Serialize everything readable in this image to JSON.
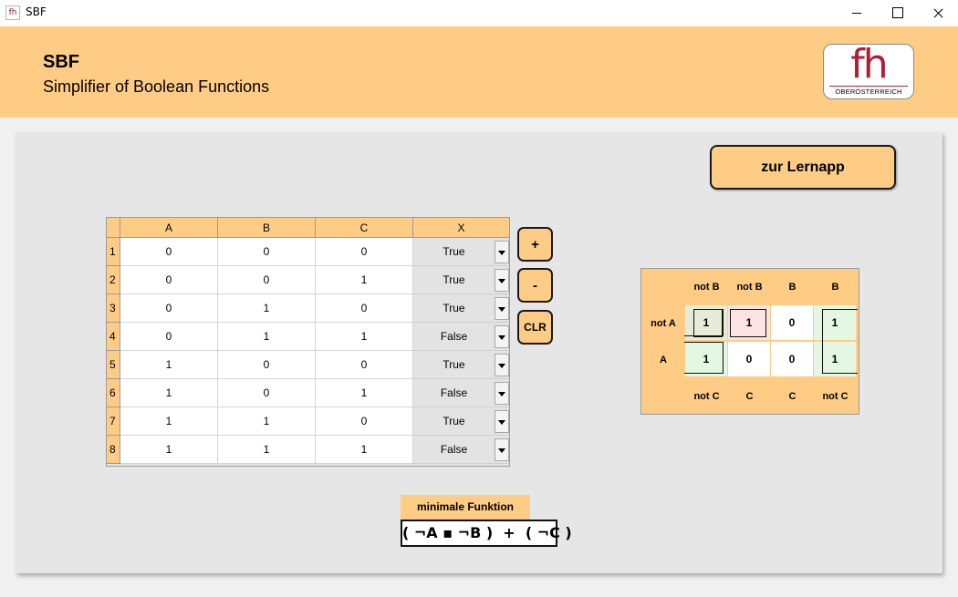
{
  "window": {
    "icon_text": "fh",
    "title": "SBF"
  },
  "header": {
    "app_name": "SBF",
    "subtitle": "Simplifier of Boolean Functions",
    "logo": {
      "letters": "fh",
      "text": "OBERÖSTERREICH"
    }
  },
  "lernapp_button": "zur Lernapp",
  "truth_table": {
    "columns": [
      "A",
      "B",
      "C",
      "X"
    ],
    "rows": [
      {
        "num": "1",
        "a": "0",
        "b": "0",
        "c": "0",
        "x": "True"
      },
      {
        "num": "2",
        "a": "0",
        "b": "0",
        "c": "1",
        "x": "True"
      },
      {
        "num": "3",
        "a": "0",
        "b": "1",
        "c": "0",
        "x": "True"
      },
      {
        "num": "4",
        "a": "0",
        "b": "1",
        "c": "1",
        "x": "False"
      },
      {
        "num": "5",
        "a": "1",
        "b": "0",
        "c": "0",
        "x": "True"
      },
      {
        "num": "6",
        "a": "1",
        "b": "0",
        "c": "1",
        "x": "False"
      },
      {
        "num": "7",
        "a": "1",
        "b": "1",
        "c": "0",
        "x": "True"
      },
      {
        "num": "8",
        "a": "1",
        "b": "1",
        "c": "1",
        "x": "False"
      }
    ]
  },
  "side_buttons": {
    "add": "+",
    "remove": "-",
    "clear": "CLR"
  },
  "kmap": {
    "top_headers": [
      "not B",
      "not B",
      "B",
      "B"
    ],
    "row_headers": [
      "not A",
      "A"
    ],
    "bottom_headers": [
      "not C",
      "C",
      "C",
      "not C"
    ],
    "cells": [
      [
        "1",
        "1",
        "0",
        "1"
      ],
      [
        "1",
        "0",
        "0",
        "1"
      ]
    ],
    "colors": {
      "green": "#e3f7e3",
      "red": "#fbe3e3",
      "overlap": "#e6ecd8"
    }
  },
  "minimal_function": {
    "label": "minimale Funktion",
    "result": "( ¬A ▪ ¬B )  +  ( ¬C )"
  }
}
